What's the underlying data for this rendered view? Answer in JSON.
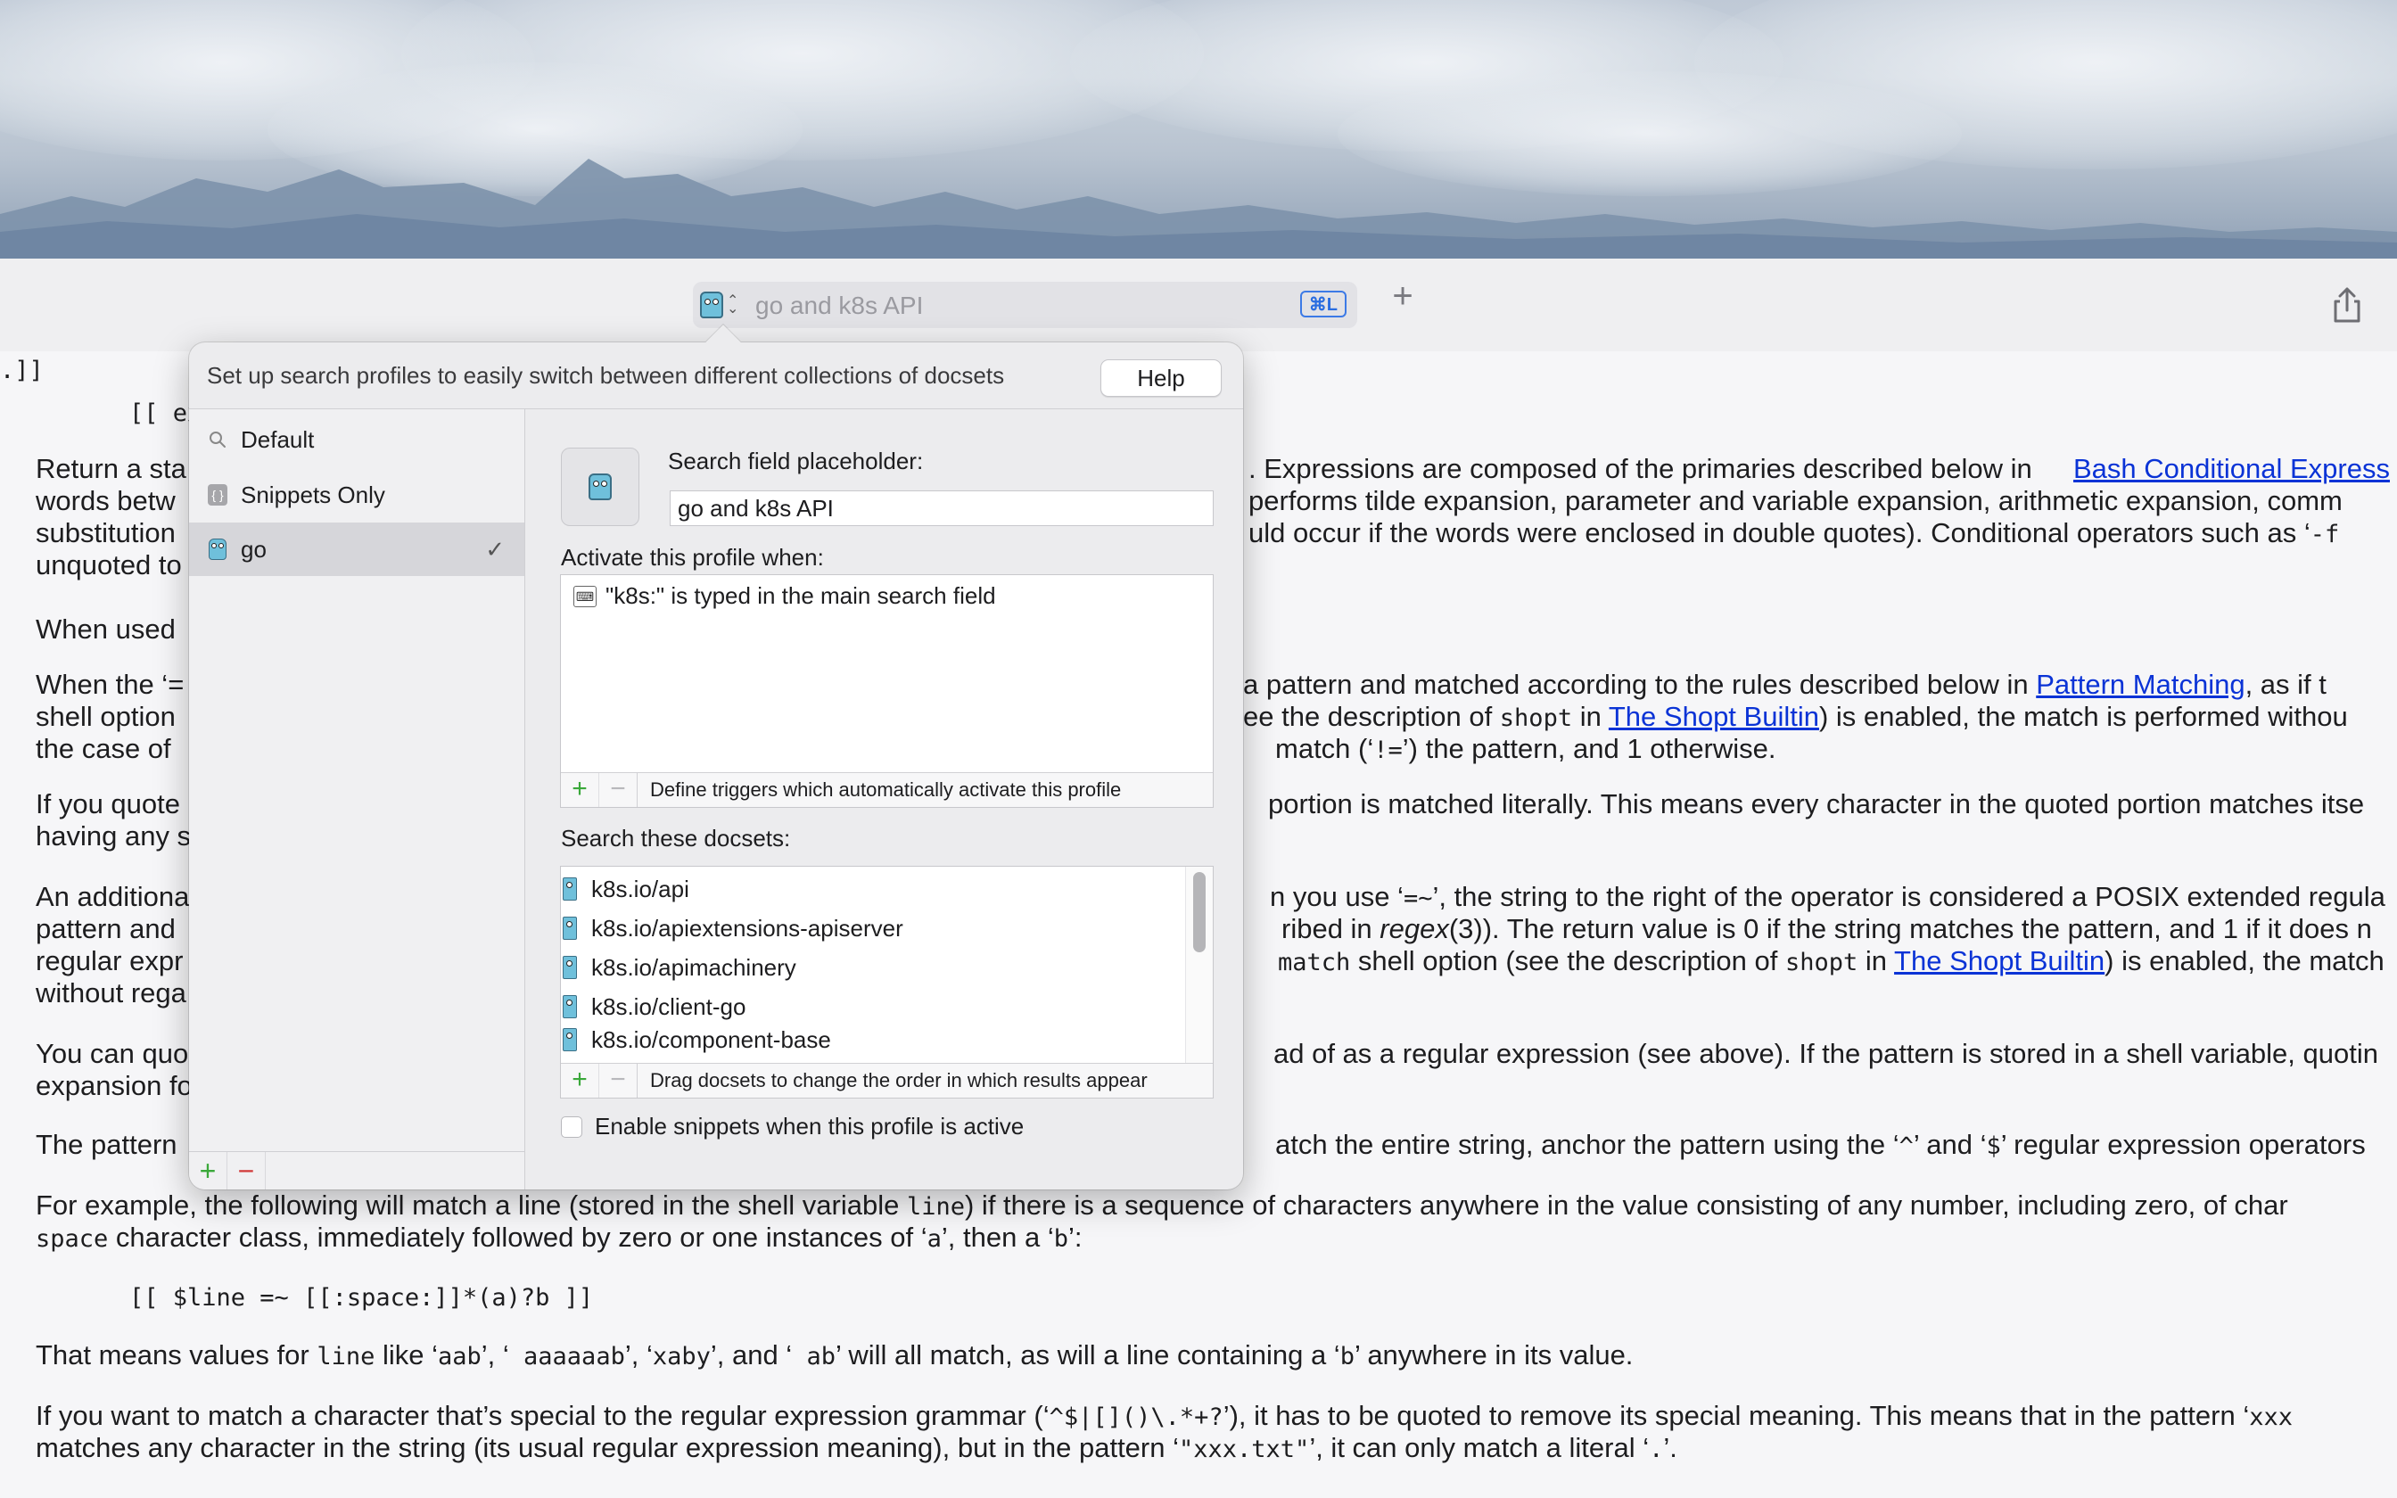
{
  "search": {
    "placeholder": "go and k8s API",
    "shortcut": "⌘L"
  },
  "doc": {
    "line0": ".]]",
    "line1_code": "[[ ex",
    "p1": [
      "Return a sta",
      ". Expressions are composed of the primaries described below in ",
      "Bash Conditional Express",
      "words betw",
      " performs tilde expansion, parameter and variable expansion, arithmetic expansion, comm",
      "substitution",
      "uld occur if the words were enclosed in double quotes). Conditional operators such as ‘",
      "-f",
      "unquoted to"
    ],
    "p2": "When used",
    "p3": {
      "l1a": "When the ‘=",
      "l1b": "a pattern and matched according to the rules described below in ",
      "l1link": "Pattern Matching",
      "l1c": ", as if t",
      "l2a": "shell option",
      "l2b": "ee the description of ",
      "l2code": "shopt",
      "l2c": " in ",
      "l2link": "The Shopt Builtin",
      "l2d": ") is enabled, the match is performed withou",
      "l3a": "the case of",
      "l3b": " match (‘",
      "l3code": "!=",
      "l3c": "’) the pattern, and 1 otherwise."
    },
    "p4": {
      "l1a": "If you quote",
      "l1b": "portion is matched literally. This means every character in the quoted portion matches itse",
      "l2a": "having any s"
    },
    "p5": {
      "l1a": "An additiona",
      "l1b": "n you use ‘",
      "l1code": "=~",
      "l1c": "’, the string to the right of the operator is considered a POSIX extended regula",
      "l2a": "pattern and",
      "l2b": "ribed in ",
      "l2em": "regex",
      "l2c": "(3)). The return value is 0 if the string matches the pattern, and 1 if it does n",
      "l3a": "regular expr",
      "l3code": "match",
      "l3b": " shell option (see the description of ",
      "l3code2": "shopt",
      "l3c": " in ",
      "l3link": "The Shopt Builtin",
      "l3d": ") is enabled, the match",
      "l4a": "without rega"
    },
    "p6": {
      "l1a": "You can quo",
      "l1b": "ad of as a regular expression (see above). If the pattern is stored in a shell variable, quotin",
      "l2a": "expansion fo"
    },
    "p7": {
      "l1a": "The pattern",
      "l1b": "atch the entire string, anchor the pattern using the ‘",
      "l1code": "^",
      "l1c": "’ and ‘",
      "l1code2": "$",
      "l1d": "’ regular expression operators"
    },
    "p8": {
      "l1a": "For example, the following will match a line (stored in the shell variable ",
      "l1code": "line",
      "l1b": ") if there is a sequence of characters anywhere in the value consisting of any number, including zero, of char",
      "l2code": "space",
      "l2a": " character class, immediately followed by zero or one instances of ‘",
      "l2code2": "a",
      "l2b": "’, then a ‘",
      "l2code3": "b",
      "l2c": "’:"
    },
    "code_example": "[[ $line =~ [[:space:]]*(a)?b ]]",
    "p9": {
      "a": "That means values for ",
      "code": "line",
      "b": " like ‘",
      "c1": "aab",
      "c": "’, ‘",
      "c2": " aaaaaab",
      "d": "’, ‘",
      "c3": "xaby",
      "e": "’, and ‘",
      "c4": " ab",
      "f": "’ will all match, as will a line containing a ‘",
      "c5": "b",
      "g": "’ anywhere in its value."
    },
    "p10": {
      "l1a": "If you want to match a character that’s special to the regular expression grammar (‘",
      "l1code": "^$|[]()\\.*+?",
      "l1b": "’), it has to be quoted to remove its special meaning. This means that in the pattern ‘",
      "l1code2": "xxx",
      "l2a": "matches any character in the string (its usual regular expression meaning), but in the pattern ‘",
      "l2code": "\"xxx.txt\"",
      "l2b": "’, it can only match a literal ‘",
      "l2code2": ".",
      "l2c": "’."
    }
  },
  "popover": {
    "header": "Set up search profiles to easily switch between different collections of docsets",
    "help": "Help",
    "profiles": [
      {
        "label": "Default",
        "icon": "search-icon"
      },
      {
        "label": "Snippets Only",
        "icon": "snippet-icon"
      },
      {
        "label": "go",
        "icon": "gopher-icon",
        "selected": true
      }
    ],
    "placeholder_label": "Search field placeholder:",
    "placeholder_value": "go and k8s API",
    "activate_label": "Activate this profile when:",
    "trigger": "\"k8s:\" is typed in the main search field",
    "trigger_hint": "Define triggers which automatically activate this profile",
    "docsets_label": "Search these docsets:",
    "docsets": [
      "k8s.io/api",
      "k8s.io/apiextensions-apiserver",
      "k8s.io/apimachinery",
      "k8s.io/client-go",
      "k8s.io/component-base"
    ],
    "docsets_hint": "Drag docsets to change the order in which results appear",
    "snippets_label": "Enable snippets when this profile is active",
    "snippets_enabled": false
  },
  "colors": {
    "link": "#0a33d6",
    "shortcut_badge": "#2a6de0",
    "add": "#3aa83a",
    "remove": "#d23b3b"
  }
}
